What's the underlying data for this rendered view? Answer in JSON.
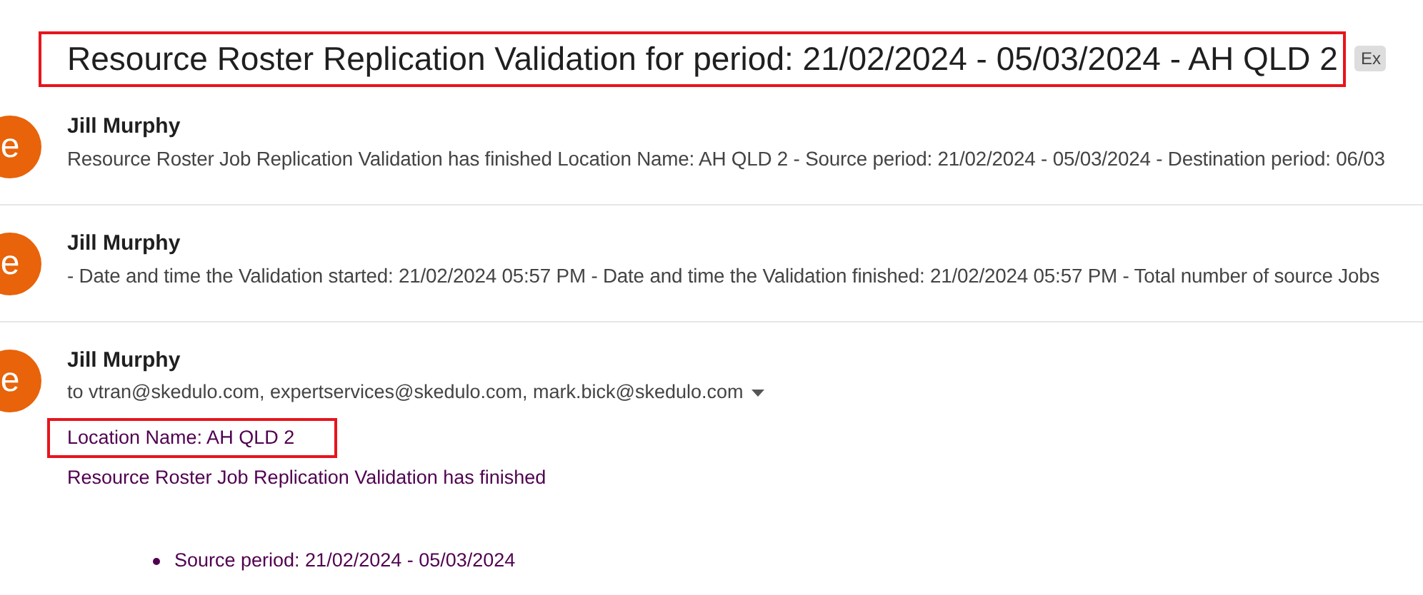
{
  "subject": {
    "text": "Resource Roster Replication Validation for period: 21/02/2024 - 05/03/2024 - AH QLD 2",
    "highlighted": true,
    "label": "Ex"
  },
  "messages": [
    {
      "avatar": "e",
      "sender": "Jill Murphy",
      "expanded": false,
      "snippet": "Resource Roster Job Replication Validation has finished Location Name: AH QLD 2 - Source period: 21/02/2024 - 05/03/2024 - Destination period: 06/03"
    },
    {
      "avatar": "e",
      "sender": "Jill Murphy",
      "expanded": false,
      "snippet": "- Date and time the Validation started: 21/02/2024 05:57 PM - Date and time the Validation finished: 21/02/2024 05:57 PM - Total number of source Jobs"
    },
    {
      "avatar": "e",
      "sender": "Jill Murphy",
      "expanded": true,
      "recipients": "to vtran@skedulo.com, expertservices@skedulo.com, mark.bick@skedulo.com",
      "body": [
        {
          "kind": "line",
          "text": "Location Name: AH QLD 2",
          "highlighted": true
        },
        {
          "kind": "line",
          "text": "Resource Roster Job Replication Validation has finished",
          "highlighted": false
        },
        {
          "kind": "bullet",
          "text": "Source period: 21/02/2024 - 05/03/2024",
          "highlighted": false
        }
      ]
    }
  ]
}
